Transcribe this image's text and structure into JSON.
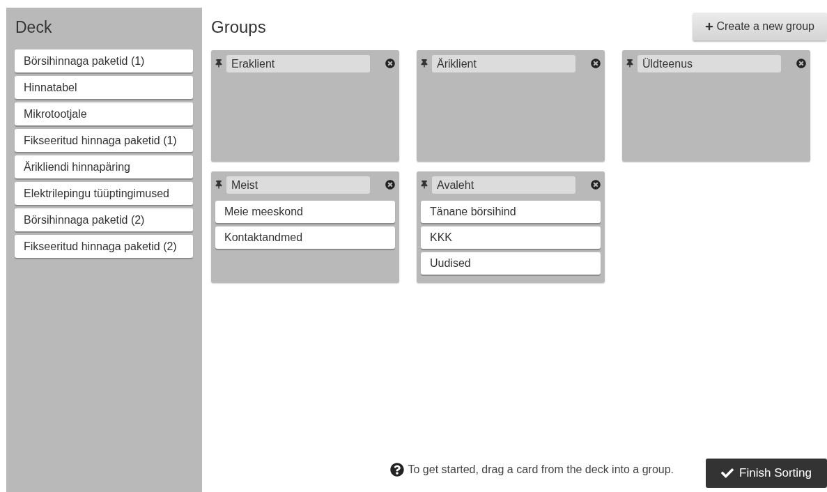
{
  "deck": {
    "title": "Deck",
    "cards": [
      {
        "label": "Börsihinnaga paketid (1)"
      },
      {
        "label": "Hinnatabel"
      },
      {
        "label": "Mikrotootjale"
      },
      {
        "label": "Fikseeritud hinnaga paketid (1)"
      },
      {
        "label": "Ärikliendi hinnapäring"
      },
      {
        "label": "Elektrilepingu tüüptingimused"
      },
      {
        "label": "Börsihinnaga paketid (2)"
      },
      {
        "label": "Fikseeritud hinnaga paketid (2)"
      }
    ]
  },
  "groups_panel": {
    "title": "Groups",
    "create_button": "Create a new group",
    "groups": [
      {
        "name": "Eraklient"
      },
      {
        "name": "Äriklient"
      },
      {
        "name": "Üldteenus"
      },
      {
        "name": "Meist",
        "cards": [
          {
            "label": "Meie meeskond"
          },
          {
            "label": "Kontaktandmed"
          }
        ]
      },
      {
        "name": "Avaleht",
        "cards": [
          {
            "label": "Tänane börsihind"
          },
          {
            "label": "KKK"
          },
          {
            "label": "Uudised"
          }
        ]
      }
    ]
  },
  "footer": {
    "hint": "To get started, drag a card from the deck into a group.",
    "finish_button": "Finish Sorting"
  }
}
